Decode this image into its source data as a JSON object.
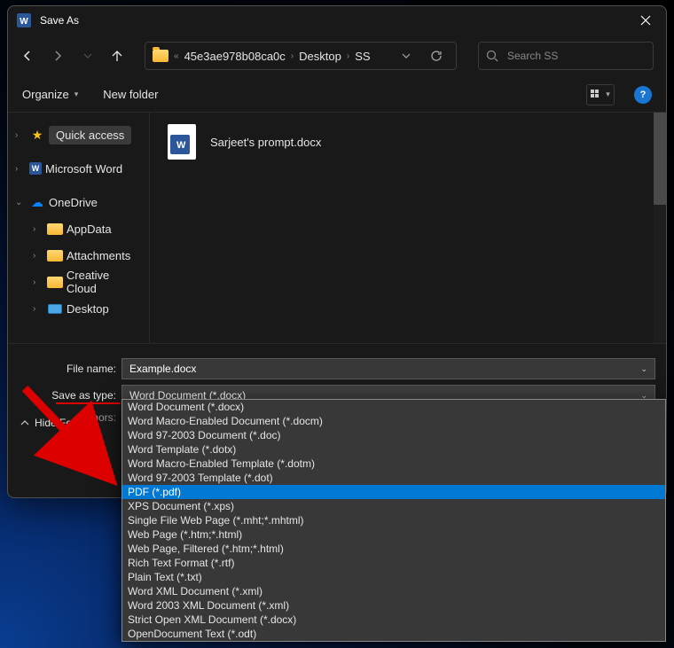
{
  "window": {
    "title": "Save As"
  },
  "nav": {
    "breadcrumbs": [
      "45e3ae978b08ca0c",
      "Desktop",
      "SS"
    ],
    "search_placeholder": "Search SS"
  },
  "toolbar": {
    "organize": "Organize",
    "new_folder": "New folder"
  },
  "sidebar": {
    "quick_access": "Quick access",
    "ms_word": "Microsoft Word",
    "onedrive": "OneDrive",
    "children": [
      "AppData",
      "Attachments",
      "Creative Cloud",
      "Desktop"
    ]
  },
  "files": [
    {
      "name": "Sarjeet's prompt.docx"
    }
  ],
  "form": {
    "file_name_label": "File name:",
    "file_name_value": "Example.docx",
    "save_type_label": "Save as type:",
    "save_type_value": "Word Document (*.docx)",
    "authors_label": "Authors:"
  },
  "type_options": [
    "Word Document (*.docx)",
    "Word Macro-Enabled Document (*.docm)",
    "Word 97-2003 Document (*.doc)",
    "Word Template (*.dotx)",
    "Word Macro-Enabled Template (*.dotm)",
    "Word 97-2003 Template (*.dot)",
    "PDF (*.pdf)",
    "XPS Document (*.xps)",
    "Single File Web Page (*.mht;*.mhtml)",
    "Web Page (*.htm;*.html)",
    "Web Page, Filtered (*.htm;*.html)",
    "Rich Text Format (*.rtf)",
    "Plain Text (*.txt)",
    "Word XML Document (*.xml)",
    "Word 2003 XML Document (*.xml)",
    "Strict Open XML Document (*.docx)",
    "OpenDocument Text (*.odt)"
  ],
  "selected_type_index": 6,
  "hide_folders": "Hide Folders"
}
